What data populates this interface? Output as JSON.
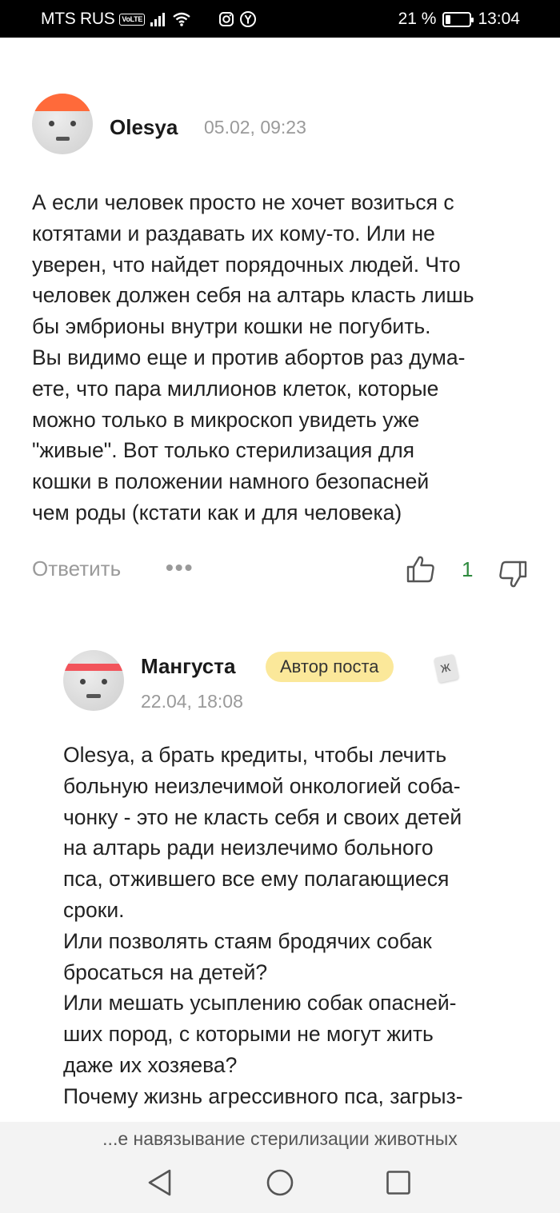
{
  "status_bar": {
    "carrier": "MTS RUS",
    "volte": "VoLTE",
    "battery_percent": "21 %",
    "battery_level": 0.21,
    "time": "13:04",
    "icons": [
      "signal-icon",
      "wifi-icon",
      "instagram-icon",
      "yandex-icon",
      "battery-icon"
    ]
  },
  "comment1": {
    "author": "Olesya",
    "date": "05.02, 09:23",
    "lines": [
      "А если человек просто не хочет возиться с",
      "котятами и раздавать их кому-то. Или не",
      "уверен, что найдет порядочных людей. Что",
      "человек должен себя на алтарь класть лишь",
      "бы эмбрионы внутри кошки не погубить.",
      "Вы видимо еще и против абортов раз дума-",
      "ете, что пара миллионов клеток, которые",
      "можно только в микроскоп увидеть уже",
      "\"живые\". Вот только стерилизация для",
      "кошки в положении намного безопасней",
      "чем роды (кстати как и для человека)"
    ],
    "reply_label": "Ответить",
    "more_label": "•••",
    "rating": "1"
  },
  "comment2": {
    "author": "Мангуста",
    "badge": "Автор поста",
    "date": "22.04, 18:08",
    "lines": [
      "Olesya, а брать кредиты, чтобы лечить",
      "больную неизлечимой онкологией соба-",
      "чонку - это не класть себя и своих детей",
      "на алтарь ради неизлечимо больного",
      "пса, отжившего все ему полагающиеся",
      "сроки.",
      "Или позволять стаям бродячих собак",
      "бросаться на детей?",
      "Или мешать усыплению собак опасней-",
      "ших пород, с которыми не могут жить",
      "даже их хозяева?",
      "Почему жизнь агрессивного пса, загрыз-"
    ]
  },
  "bottom": {
    "post_title": "...е навязывание стерилизации животных"
  },
  "colors": {
    "rating_positive": "#2e8a3e",
    "badge_bg": "#fbe89a",
    "avatar1_cap": "#ff6a3a",
    "avatar2_band": "#f2545b"
  }
}
